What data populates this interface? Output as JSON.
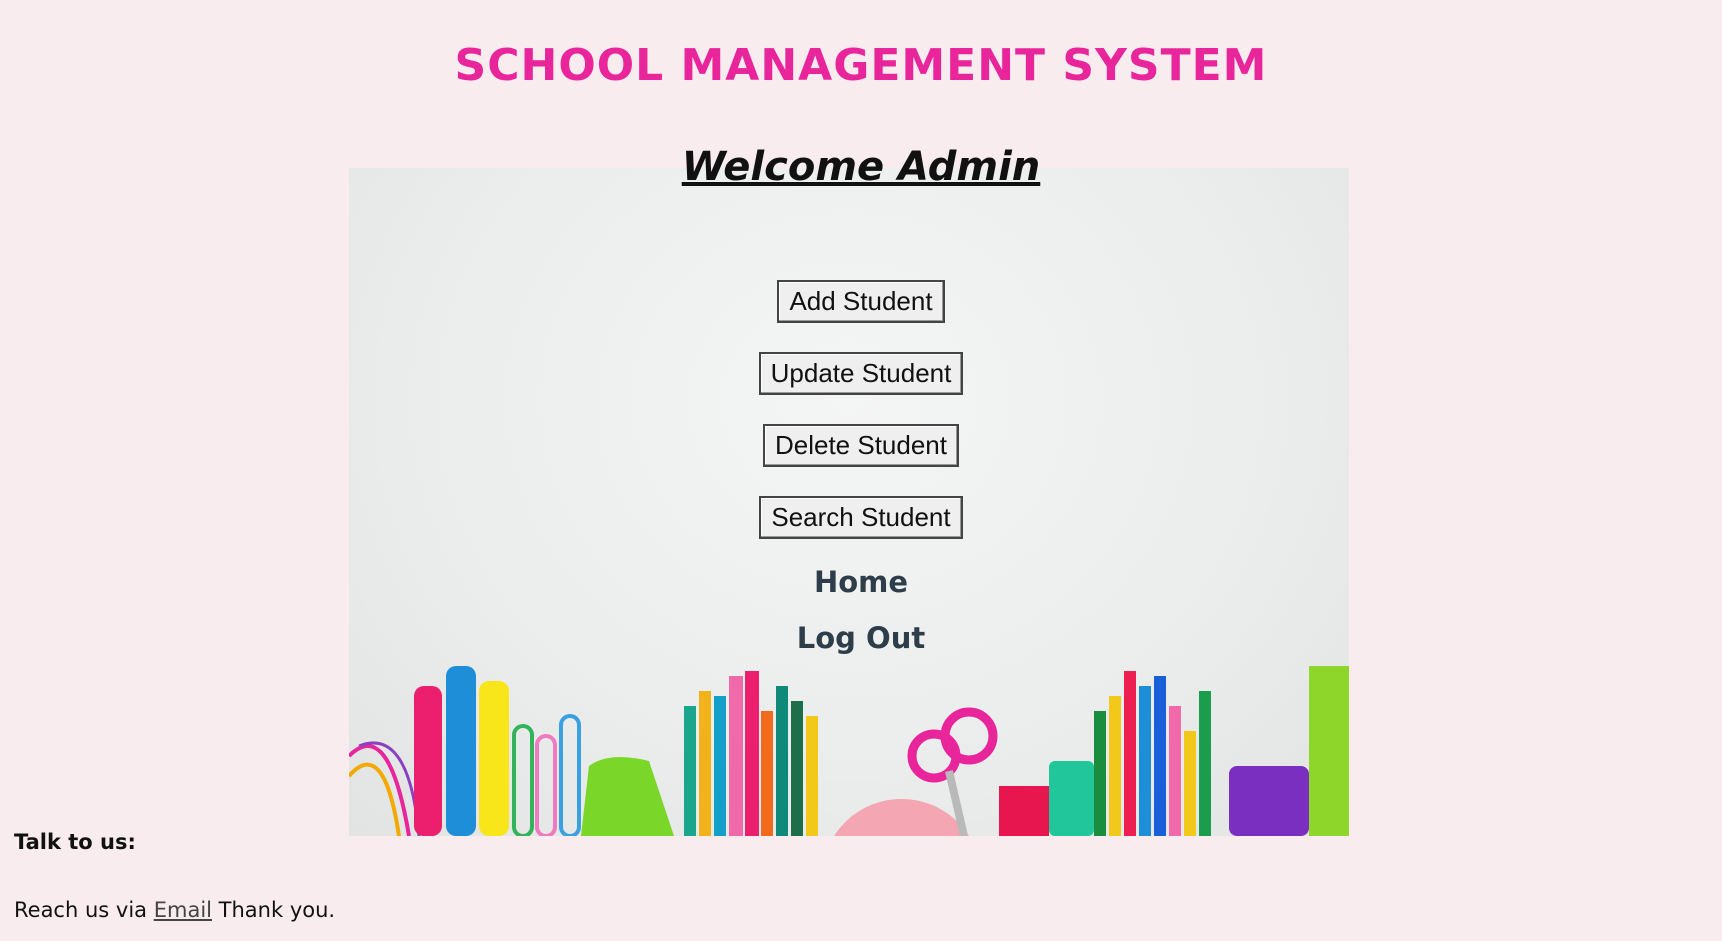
{
  "header": {
    "title": "SCHOOL MANAGEMENT SYSTEM"
  },
  "welcome": {
    "text": "Welcome Admin"
  },
  "actions": {
    "add_label": "Add Student",
    "update_label": "Update Student",
    "delete_label": "Delete Student",
    "search_label": "Search Student"
  },
  "nav": {
    "home_label": "Home",
    "logout_label": "Log Out"
  },
  "footer": {
    "heading": "Talk to us:",
    "reach_prefix": "Reach us via",
    "email_label": "Email",
    "thanks": "Thank you."
  },
  "colors": {
    "page_background": "#f9ecee",
    "title_color": "#e8259a",
    "nav_link_color": "#2d3e4a"
  },
  "icons": {
    "hero_image": "school-supplies-image"
  }
}
